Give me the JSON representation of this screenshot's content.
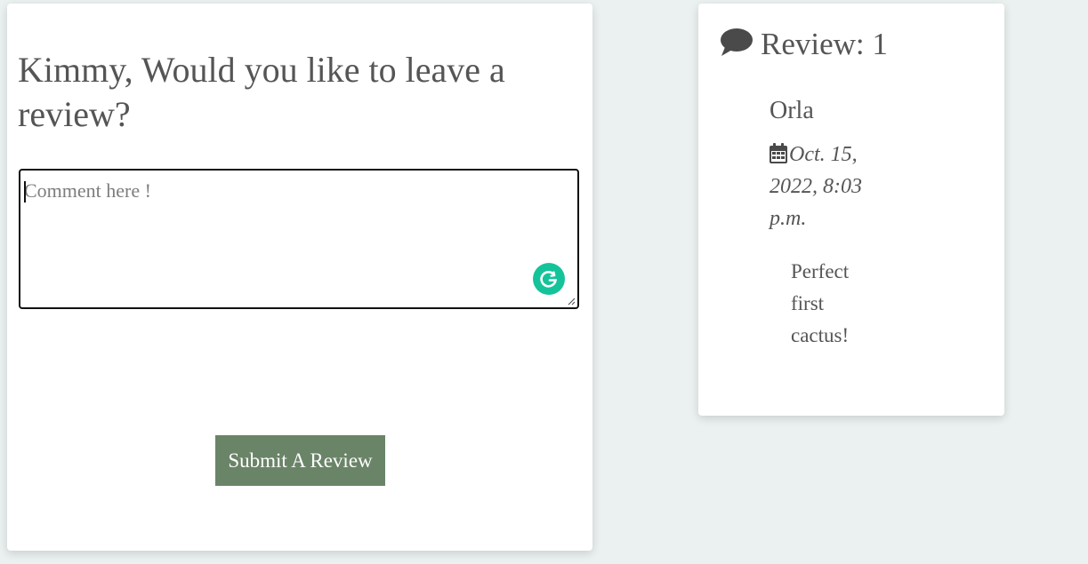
{
  "review_form": {
    "heading": "Kimmy, Would you like to leave a review?",
    "comment_placeholder": "Comment here !",
    "comment_value": "",
    "submit_label": "Submit A Review",
    "grammarly_icon": "grammarly-g-icon"
  },
  "reviews_panel": {
    "title": "Review: 1",
    "title_icon": "comment-icon",
    "items": [
      {
        "author": "Orla",
        "date_icon": "calendar-icon",
        "date": "Oct. 15, 2022, 8:03 p.m.",
        "body": "Perfect first cactus!"
      }
    ]
  },
  "colors": {
    "page_background": "#ebf1f0",
    "card_background": "#ffffff",
    "submit_button": "#6a8467",
    "grammarly": "#15c39a",
    "text": "#555555"
  }
}
